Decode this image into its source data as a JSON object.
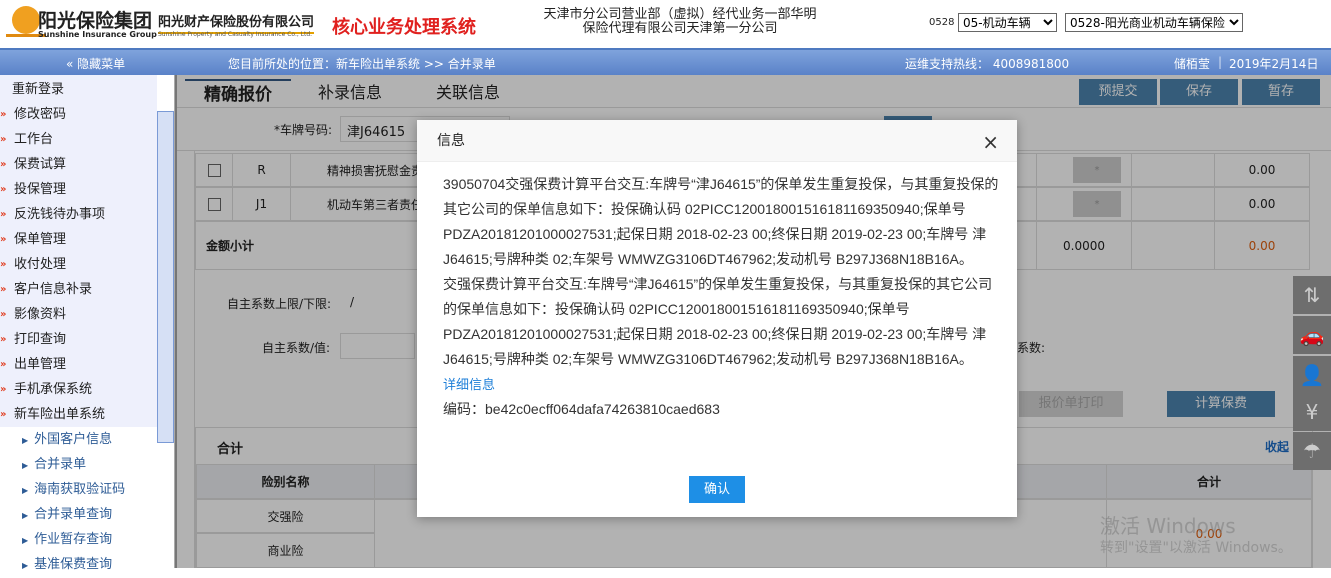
{
  "header": {
    "logo_cn": "阳光保险集团",
    "logo_en": "Sunshine Insurance Group",
    "company_cn": "阳光财产保险股份有限公司",
    "company_en": "Sunshine Property and Casualty Insurance Co., Ltd.",
    "system_title": "核心业务处理系统",
    "org_line1": "天津市分公司营业部（虚拟）经代业务一部华明",
    "org_line2": "保险代理有限公司天津第一分公司",
    "code": "0528",
    "select1": "05-机动车辆",
    "select2": "0528-阳光商业机动车辆保险"
  },
  "nav": {
    "hide_menu": "«  隐藏菜单",
    "location": "您目前所处的位置：新车险出单系统 >> 合并录单",
    "hotline": "运维支持热线：  4008981800",
    "user": "储栢莹",
    "date": "2019年2月14日",
    "sep": "|"
  },
  "sidebar": {
    "relogin": "重新登录",
    "arrow": "»",
    "items": [
      "修改密码",
      "工作台",
      "保费试算",
      "投保管理",
      "反洗钱待办事项",
      "保单管理",
      "收付处理",
      "客户信息补录",
      "影像资料",
      "打印查询",
      "出单管理",
      "手机承保系统",
      "新车险出单系统"
    ],
    "subitems": [
      "外国客户信息",
      "合并录单",
      "海南获取验证码",
      "合并录单查询",
      "作业暂存查询",
      "基准保费查询"
    ]
  },
  "main": {
    "tabs": [
      "精确报价",
      "补录信息",
      "关联信息"
    ],
    "buttons": [
      "预提交",
      "保存",
      "暂存"
    ],
    "plate_label": "*车牌号码:",
    "plate_value": "津J64615",
    "rows": [
      {
        "code": "R",
        "name": "精神损害抚慰金责任",
        "value": "0.00",
        "star": "*"
      },
      {
        "code": "J1",
        "name": "机动车第三者责任",
        "value": "0.00",
        "star": "*"
      }
    ],
    "subtotal_label": "金额小计",
    "subtotal_rate": "0.0000",
    "subtotal_value": "0.00",
    "coef_limit_label": "自主系数上限/下限:",
    "coef_limit_value": "/",
    "coef_value_label": "自主系数/值:",
    "coef_right_label": "系数:",
    "print_button": "报价单打印",
    "calc_button": "计算保费",
    "total_label": "合计",
    "collapse": "收起",
    "col_name": "险别名称",
    "col_total": "合计",
    "total_rows": [
      "交强险",
      "商业险"
    ],
    "total_value": "0.00"
  },
  "watermark": {
    "line1": "激活 Windows",
    "line2": "转到\"设置\"以激活 Windows。"
  },
  "modal": {
    "title": "信息",
    "close": "×",
    "para1": "39050704交强保费计算平台交互:车牌号“津J64615”的保单发生重复投保，与其重复投保的其它公司的保单信息如下：投保确认码 02PICC120018001516181169350940;保单号 PDZA20181201000027531;起保日期 2018-02-23 00;终保日期 2019-02-23 00;车牌号 津J64615;号牌种类 02;车架号 WMWZG3106DT467962;发动机号 B297J368N18B16A。",
    "para2": "交强保费计算平台交互:车牌号“津J64615”的保单发生重复投保，与其重复投保的其它公司的保单信息如下：投保确认码 02PICC120018001516181169350940;保单号 PDZA20181201000027531;起保日期 2018-02-23 00;终保日期 2019-02-23 00;车牌号 津J64615;号牌种类 02;车架号 WMWZG3106DT467962;发动机号 B297J368N18B16A。",
    "detail_link": "详细信息",
    "code_line": "编码：be42c0ecff064dafa74263810caed683",
    "ok": "确认"
  }
}
